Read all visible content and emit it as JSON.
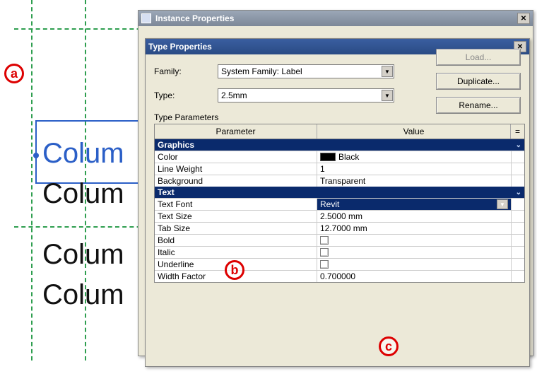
{
  "annotations": {
    "a": "a",
    "b": "b",
    "c": "c"
  },
  "bg": {
    "line1": "Colum",
    "line2": "Colum",
    "line3": "Colum",
    "line4": "Colum"
  },
  "instance_window": {
    "title": "Instance Properties"
  },
  "type_window": {
    "title": "Type Properties",
    "family_label": "Family:",
    "family_value": "System Family: Label",
    "type_label": "Type:",
    "type_value": "2.5mm",
    "btn_load": "Load...",
    "btn_duplicate": "Duplicate...",
    "btn_rename": "Rename...",
    "params_label": "Type Parameters",
    "headers": {
      "param": "Parameter",
      "value": "Value",
      "ext": "="
    },
    "groups": {
      "graphics": "Graphics",
      "text": "Text"
    },
    "rows": {
      "color": {
        "p": "Color",
        "v": "Black"
      },
      "lineweight": {
        "p": "Line Weight",
        "v": "1"
      },
      "background": {
        "p": "Background",
        "v": "Transparent"
      },
      "textfont": {
        "p": "Text Font",
        "v": "Revit"
      },
      "textsize": {
        "p": "Text Size",
        "v": "2.5000 mm"
      },
      "tabsize": {
        "p": "Tab Size",
        "v": "12.7000 mm"
      },
      "bold": {
        "p": "Bold"
      },
      "italic": {
        "p": "Italic"
      },
      "underline": {
        "p": "Underline"
      },
      "widthfactor": {
        "p": "Width Factor",
        "v": "0.700000"
      }
    }
  }
}
